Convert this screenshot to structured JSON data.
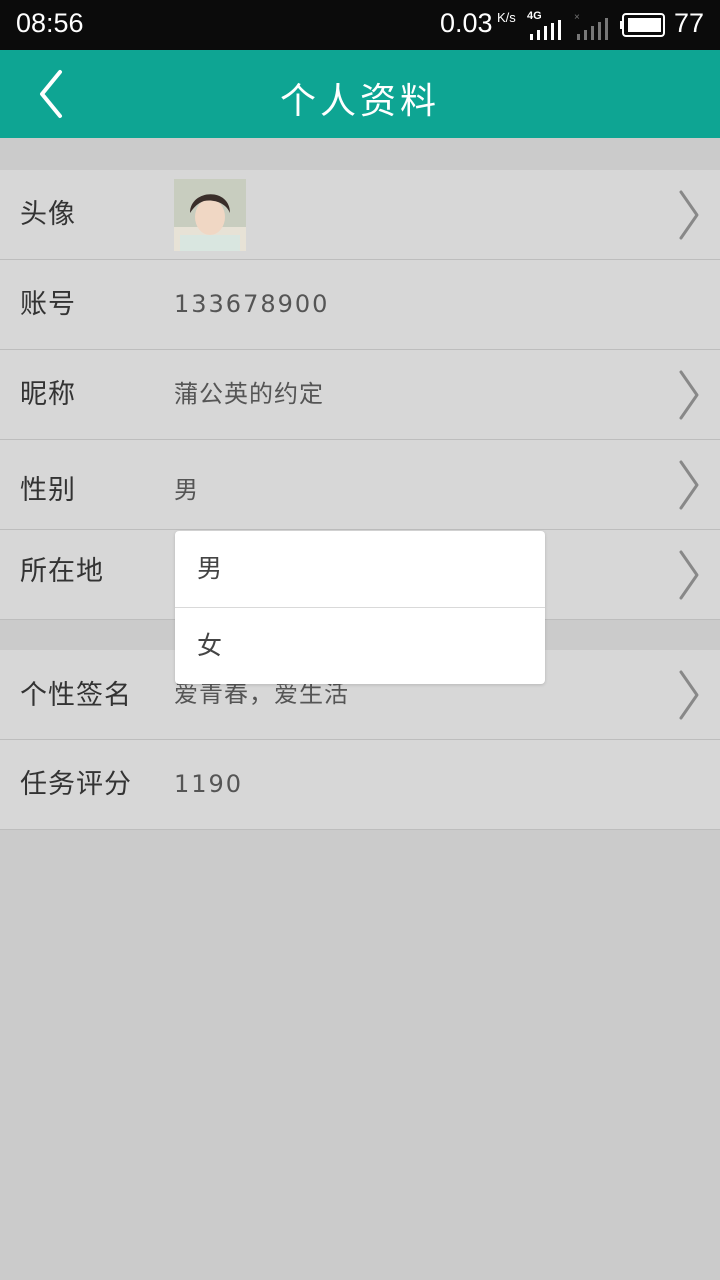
{
  "status_bar": {
    "time": "08:56",
    "net_speed": "0.03",
    "net_speed_unit": "K/s",
    "network_type": "4G",
    "battery_level": "77"
  },
  "app_bar": {
    "title": "个人资料",
    "back_icon": "chevron-left-icon"
  },
  "profile": {
    "avatar": {
      "label": "头像"
    },
    "account": {
      "label": "账号",
      "value": "133678900"
    },
    "nickname": {
      "label": "昵称",
      "value": "蒲公英的约定"
    },
    "gender": {
      "label": "性别",
      "value": "男"
    },
    "location": {
      "label": "所在地",
      "value": ""
    },
    "signature": {
      "label": "个性签名",
      "value": "爱青春，爱生活"
    },
    "task_score": {
      "label": "任务评分",
      "value": "1190"
    }
  },
  "gender_picker": {
    "options": [
      "男",
      "女"
    ]
  },
  "colors": {
    "app_bar": "#0ea593",
    "status_bar": "#0b0b0b",
    "row_background": "#d7d7d7",
    "page_background": "#cbcbcb"
  }
}
